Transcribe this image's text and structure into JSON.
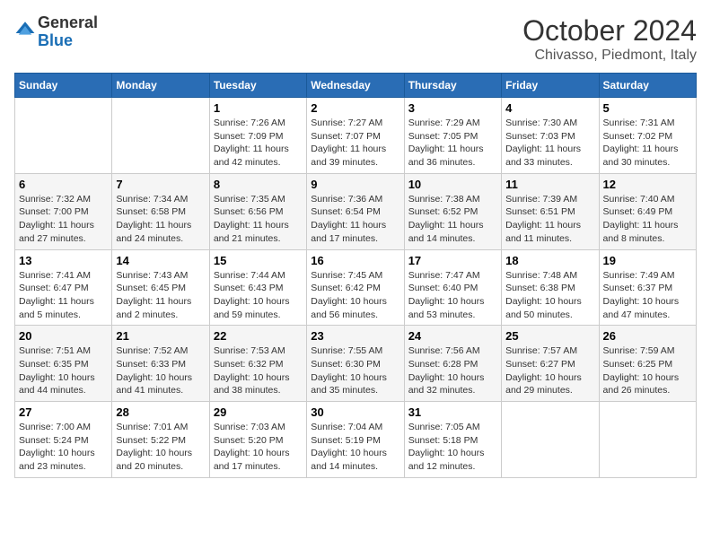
{
  "header": {
    "logo_general": "General",
    "logo_blue": "Blue",
    "month_title": "October 2024",
    "location": "Chivasso, Piedmont, Italy"
  },
  "days_of_week": [
    "Sunday",
    "Monday",
    "Tuesday",
    "Wednesday",
    "Thursday",
    "Friday",
    "Saturday"
  ],
  "weeks": [
    [
      {
        "day": "",
        "info": ""
      },
      {
        "day": "",
        "info": ""
      },
      {
        "day": "1",
        "info": "Sunrise: 7:26 AM\nSunset: 7:09 PM\nDaylight: 11 hours and 42 minutes."
      },
      {
        "day": "2",
        "info": "Sunrise: 7:27 AM\nSunset: 7:07 PM\nDaylight: 11 hours and 39 minutes."
      },
      {
        "day": "3",
        "info": "Sunrise: 7:29 AM\nSunset: 7:05 PM\nDaylight: 11 hours and 36 minutes."
      },
      {
        "day": "4",
        "info": "Sunrise: 7:30 AM\nSunset: 7:03 PM\nDaylight: 11 hours and 33 minutes."
      },
      {
        "day": "5",
        "info": "Sunrise: 7:31 AM\nSunset: 7:02 PM\nDaylight: 11 hours and 30 minutes."
      }
    ],
    [
      {
        "day": "6",
        "info": "Sunrise: 7:32 AM\nSunset: 7:00 PM\nDaylight: 11 hours and 27 minutes."
      },
      {
        "day": "7",
        "info": "Sunrise: 7:34 AM\nSunset: 6:58 PM\nDaylight: 11 hours and 24 minutes."
      },
      {
        "day": "8",
        "info": "Sunrise: 7:35 AM\nSunset: 6:56 PM\nDaylight: 11 hours and 21 minutes."
      },
      {
        "day": "9",
        "info": "Sunrise: 7:36 AM\nSunset: 6:54 PM\nDaylight: 11 hours and 17 minutes."
      },
      {
        "day": "10",
        "info": "Sunrise: 7:38 AM\nSunset: 6:52 PM\nDaylight: 11 hours and 14 minutes."
      },
      {
        "day": "11",
        "info": "Sunrise: 7:39 AM\nSunset: 6:51 PM\nDaylight: 11 hours and 11 minutes."
      },
      {
        "day": "12",
        "info": "Sunrise: 7:40 AM\nSunset: 6:49 PM\nDaylight: 11 hours and 8 minutes."
      }
    ],
    [
      {
        "day": "13",
        "info": "Sunrise: 7:41 AM\nSunset: 6:47 PM\nDaylight: 11 hours and 5 minutes."
      },
      {
        "day": "14",
        "info": "Sunrise: 7:43 AM\nSunset: 6:45 PM\nDaylight: 11 hours and 2 minutes."
      },
      {
        "day": "15",
        "info": "Sunrise: 7:44 AM\nSunset: 6:43 PM\nDaylight: 10 hours and 59 minutes."
      },
      {
        "day": "16",
        "info": "Sunrise: 7:45 AM\nSunset: 6:42 PM\nDaylight: 10 hours and 56 minutes."
      },
      {
        "day": "17",
        "info": "Sunrise: 7:47 AM\nSunset: 6:40 PM\nDaylight: 10 hours and 53 minutes."
      },
      {
        "day": "18",
        "info": "Sunrise: 7:48 AM\nSunset: 6:38 PM\nDaylight: 10 hours and 50 minutes."
      },
      {
        "day": "19",
        "info": "Sunrise: 7:49 AM\nSunset: 6:37 PM\nDaylight: 10 hours and 47 minutes."
      }
    ],
    [
      {
        "day": "20",
        "info": "Sunrise: 7:51 AM\nSunset: 6:35 PM\nDaylight: 10 hours and 44 minutes."
      },
      {
        "day": "21",
        "info": "Sunrise: 7:52 AM\nSunset: 6:33 PM\nDaylight: 10 hours and 41 minutes."
      },
      {
        "day": "22",
        "info": "Sunrise: 7:53 AM\nSunset: 6:32 PM\nDaylight: 10 hours and 38 minutes."
      },
      {
        "day": "23",
        "info": "Sunrise: 7:55 AM\nSunset: 6:30 PM\nDaylight: 10 hours and 35 minutes."
      },
      {
        "day": "24",
        "info": "Sunrise: 7:56 AM\nSunset: 6:28 PM\nDaylight: 10 hours and 32 minutes."
      },
      {
        "day": "25",
        "info": "Sunrise: 7:57 AM\nSunset: 6:27 PM\nDaylight: 10 hours and 29 minutes."
      },
      {
        "day": "26",
        "info": "Sunrise: 7:59 AM\nSunset: 6:25 PM\nDaylight: 10 hours and 26 minutes."
      }
    ],
    [
      {
        "day": "27",
        "info": "Sunrise: 7:00 AM\nSunset: 5:24 PM\nDaylight: 10 hours and 23 minutes."
      },
      {
        "day": "28",
        "info": "Sunrise: 7:01 AM\nSunset: 5:22 PM\nDaylight: 10 hours and 20 minutes."
      },
      {
        "day": "29",
        "info": "Sunrise: 7:03 AM\nSunset: 5:20 PM\nDaylight: 10 hours and 17 minutes."
      },
      {
        "day": "30",
        "info": "Sunrise: 7:04 AM\nSunset: 5:19 PM\nDaylight: 10 hours and 14 minutes."
      },
      {
        "day": "31",
        "info": "Sunrise: 7:05 AM\nSunset: 5:18 PM\nDaylight: 10 hours and 12 minutes."
      },
      {
        "day": "",
        "info": ""
      },
      {
        "day": "",
        "info": ""
      }
    ]
  ]
}
